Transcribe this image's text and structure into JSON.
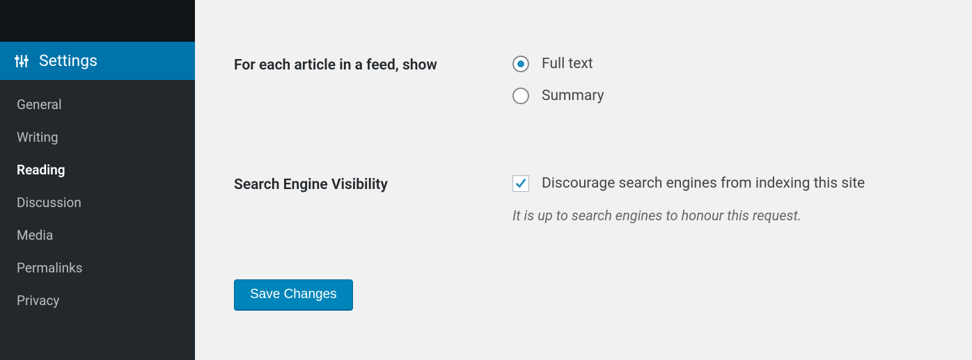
{
  "sidebar": {
    "header": {
      "label": "Settings",
      "icon": "sliders-icon"
    },
    "items": [
      {
        "label": "General",
        "current": false
      },
      {
        "label": "Writing",
        "current": false
      },
      {
        "label": "Reading",
        "current": true
      },
      {
        "label": "Discussion",
        "current": false
      },
      {
        "label": "Media",
        "current": false
      },
      {
        "label": "Permalinks",
        "current": false
      },
      {
        "label": "Privacy",
        "current": false
      }
    ]
  },
  "main": {
    "feed_row": {
      "label": "For each article in a feed, show",
      "options": [
        {
          "label": "Full text",
          "checked": true
        },
        {
          "label": "Summary",
          "checked": false
        }
      ]
    },
    "sev_row": {
      "label": "Search Engine Visibility",
      "checkbox_label": "Discourage search engines from indexing this site",
      "checked": true,
      "description": "It is up to search engines to honour this request."
    },
    "submit_label": "Save Changes"
  },
  "colors": {
    "accent": "#0073aa",
    "button": "#0085ba"
  }
}
